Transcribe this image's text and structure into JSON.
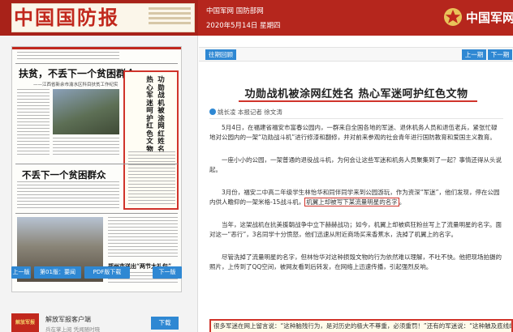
{
  "header": {
    "masthead": "中国国防报",
    "paper_name": "中国军网  国防部网",
    "date": "2020年5月14日  星期四",
    "brand": "中国军网"
  },
  "page_preview": {
    "headline": "扶贫，不丢下一个贫困群众",
    "subline": "——江西省新余市渝水区科目扶贫工作纪实",
    "mid_headline": "不丢下一个贫困群众",
    "lower_title": "郑州市送出“两节大礼包”",
    "column_1": "功勋战机被涂网红姓名",
    "column_2": "热心军迷呵护红色文物"
  },
  "page_nav": {
    "prev_label": "上一版",
    "current_label": "第01版：要闻",
    "pdf_label": "PDF版下载",
    "next_label": "下一版"
  },
  "app_promo": {
    "logo_text": "解放军报",
    "title": "解放军报客户端",
    "subtitle": "兵在掌上阅 凭闻随时晓",
    "download_label": "下载"
  },
  "toolbar": {
    "archive_label": "往期回顾",
    "prev_label": "上一期",
    "next_label": "下一期"
  },
  "article": {
    "title": "功勋战机被涂网红姓名  热心军迷呵护红色文物",
    "byline": "姚长凌  本报记者  徐文涛",
    "p1": "5月4日，在福建省福安市富春公园内，一群来自全国各地的军迷、退休机务人员和退伍老兵，紧张忙碌地对公园内的一架“功勋战斗机”进行修漆和翻修，并对前来参观的社会青年进行国防教育和爱国主义教育。",
    "p2": "一座小小的公园，一架普通的退役战斗机，为何会让这些军迷和机务人员聚集到了一起？事情还得从头说起。",
    "p3_before": "3月份，福安二中高二年级学生林怡华和同伴同学来到公园游玩，作为资深“军迷”，他们发现，停在公园内供人瞻仰的一架米格-15战斗机，",
    "p3_highlight": "机翼上却被写下某流量明星的名字",
    "p3_after": "。",
    "p4": "当年，这架战机在抗美援朝战争中立下赫赫战功；如今，机翼上却被疯狂粉丝写上了流量明星的名字。面对这一“恶行”，3名同学十分愤怒，他们迅速从附近商场买来香蕉水，洗掉了机翼上的名字。",
    "p5": "尽管洗掉了流量明星的名字，但林怡华对这种损毁文物的行为依然难以理解，不吐不快。他把现场拍摄的照片，上传到了QQ空间，被网友看到后转发，在网络上迅速传播，引起强烈反响。",
    "quote": "很多军迷在网上留言说：“这种脑残行为，是对历史的极大不尊重，必须重罚！”还有的军迷说：“这种触及底线的事情，真的又蠢又坏！追星追的脑子不要了吗？请尊重历史，尊重英雄，因为这都是先烈们流血牺牲换来的！”"
  }
}
